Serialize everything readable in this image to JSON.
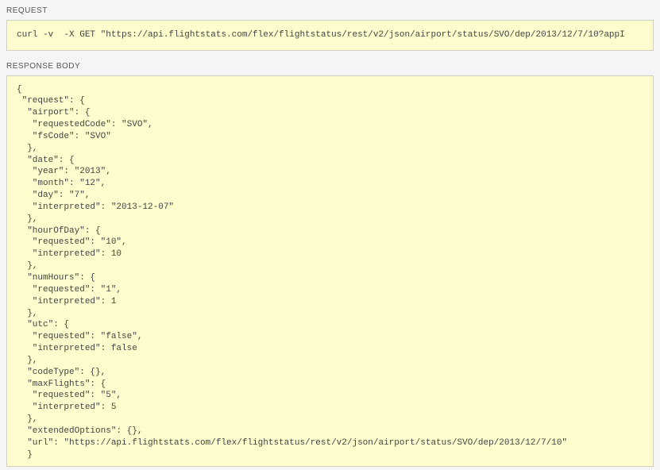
{
  "labels": {
    "request": "REQUEST",
    "responseBody": "RESPONSE BODY"
  },
  "request": {
    "command": "curl -v  -X GET \"https://api.flightstats.com/flex/flightstatus/rest/v2/json/airport/status/SVO/dep/2013/12/7/10?appI"
  },
  "response": {
    "body": "{\n \"request\": {\n  \"airport\": {\n   \"requestedCode\": \"SVO\",\n   \"fsCode\": \"SVO\"\n  },\n  \"date\": {\n   \"year\": \"2013\",\n   \"month\": \"12\",\n   \"day\": \"7\",\n   \"interpreted\": \"2013-12-07\"\n  },\n  \"hourOfDay\": {\n   \"requested\": \"10\",\n   \"interpreted\": 10\n  },\n  \"numHours\": {\n   \"requested\": \"1\",\n   \"interpreted\": 1\n  },\n  \"utc\": {\n   \"requested\": \"false\",\n   \"interpreted\": false\n  },\n  \"codeType\": {},\n  \"maxFlights\": {\n   \"requested\": \"5\",\n   \"interpreted\": 5\n  },\n  \"extendedOptions\": {},\n  \"url\": \"https://api.flightstats.com/flex/flightstatus/rest/v2/json/airport/status/SVO/dep/2013/12/7/10\"\n  }"
  }
}
